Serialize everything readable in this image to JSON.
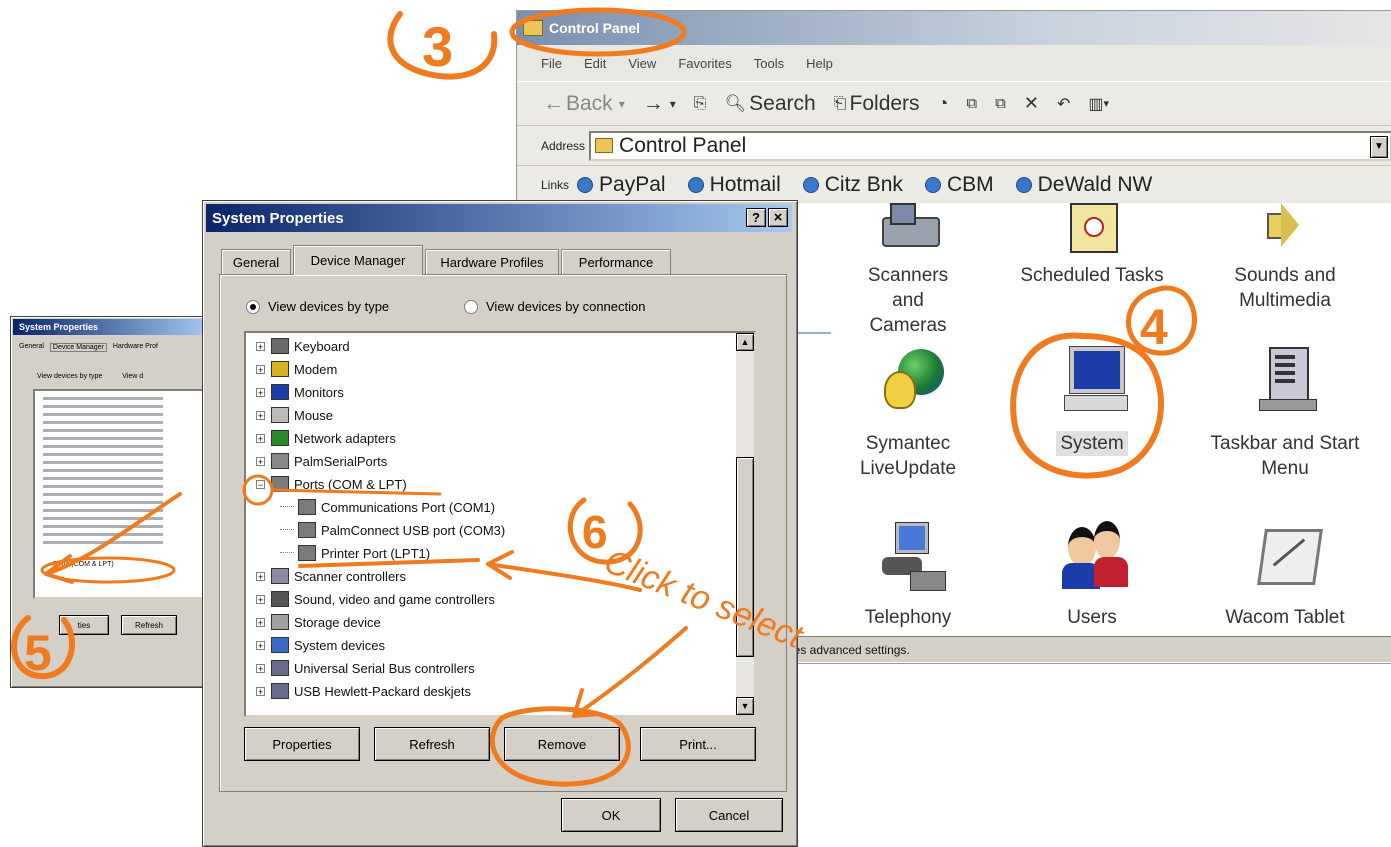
{
  "control_panel": {
    "title": "Control Panel",
    "menu": [
      "File",
      "Edit",
      "View",
      "Favorites",
      "Tools",
      "Help"
    ],
    "toolbar": {
      "back": "Back",
      "search": "Search",
      "folders": "Folders"
    },
    "address_label": "Address",
    "address_value": "Control Panel",
    "links_label": "Links",
    "links": [
      "PayPal",
      "Hotmail",
      "Citz Bnk",
      "CBM",
      "DeWald NW"
    ],
    "items": [
      {
        "label": "Scanners and Cameras",
        "icon": "scanner-icon"
      },
      {
        "label": "Scheduled Tasks",
        "icon": "scheduled-tasks-icon"
      },
      {
        "label": "Sounds and Multimedia",
        "icon": "speaker-icon"
      },
      {
        "label": "Symantec LiveUpdate",
        "icon": "globe-icon"
      },
      {
        "label": "System",
        "icon": "computer-icon"
      },
      {
        "label": "Taskbar and Start Menu",
        "icon": "taskbar-icon"
      },
      {
        "label": "Telephony",
        "icon": "telephony-icon"
      },
      {
        "label": "Users",
        "icon": "users-icon"
      },
      {
        "label": "Wacom Tablet",
        "icon": "tablet-icon"
      }
    ],
    "status_text": "ges advanced settings."
  },
  "system_properties": {
    "title": "System Properties",
    "help_btn": "?",
    "close_btn": "×",
    "tabs": [
      "General",
      "Device Manager",
      "Hardware Profiles",
      "Performance"
    ],
    "radio_by_type": "View devices by type",
    "radio_by_connection": "View devices by connection",
    "devices": [
      {
        "label": "Keyboard",
        "expander": "+",
        "indent": 0,
        "icon": "keyboard-icon"
      },
      {
        "label": "Modem",
        "expander": "+",
        "indent": 0,
        "icon": "modem-icon"
      },
      {
        "label": "Monitors",
        "expander": "+",
        "indent": 0,
        "icon": "monitor-icon"
      },
      {
        "label": "Mouse",
        "expander": "+",
        "indent": 0,
        "icon": "mouse-icon"
      },
      {
        "label": "Network adapters",
        "expander": "+",
        "indent": 0,
        "icon": "network-icon"
      },
      {
        "label": "PalmSerialPorts",
        "expander": "+",
        "indent": 0,
        "icon": "palm-icon"
      },
      {
        "label": "Ports (COM & LPT)",
        "expander": "−",
        "indent": 0,
        "icon": "port-icon"
      },
      {
        "label": "Communications Port (COM1)",
        "expander": "",
        "indent": 1,
        "icon": "port-icon"
      },
      {
        "label": "PalmConnect USB port (COM3)",
        "expander": "",
        "indent": 1,
        "icon": "port-icon"
      },
      {
        "label": "Printer Port (LPT1)",
        "expander": "",
        "indent": 1,
        "icon": "port-icon"
      },
      {
        "label": "Scanner controllers",
        "expander": "+",
        "indent": 0,
        "icon": "scanner-icon"
      },
      {
        "label": "Sound, video and game controllers",
        "expander": "+",
        "indent": 0,
        "icon": "sound-icon"
      },
      {
        "label": "Storage device",
        "expander": "+",
        "indent": 0,
        "icon": "storage-icon"
      },
      {
        "label": "System devices",
        "expander": "+",
        "indent": 0,
        "icon": "system-device-icon"
      },
      {
        "label": "Universal Serial Bus controllers",
        "expander": "+",
        "indent": 0,
        "icon": "usb-icon"
      },
      {
        "label": "USB Hewlett-Packard deskjets",
        "expander": "+",
        "indent": 0,
        "icon": "usb-icon"
      }
    ],
    "buttons": {
      "properties": "Properties",
      "refresh": "Refresh",
      "remove": "Remove",
      "print": "Print..."
    },
    "ok": "OK",
    "cancel": "Cancel"
  },
  "mini_dialog": {
    "title": "System Properties",
    "tabs": [
      "General",
      "Device Manager",
      "Hardware Prof"
    ],
    "radio": "View devices by type",
    "radio2": "View d",
    "highlighted": "Ports (COM & LPT)",
    "buttons": [
      "ties",
      "Refresh"
    ]
  },
  "annotations": {
    "step3": "3",
    "step4": "4",
    "step5": "5",
    "step6": "6",
    "note": "Click to select"
  }
}
